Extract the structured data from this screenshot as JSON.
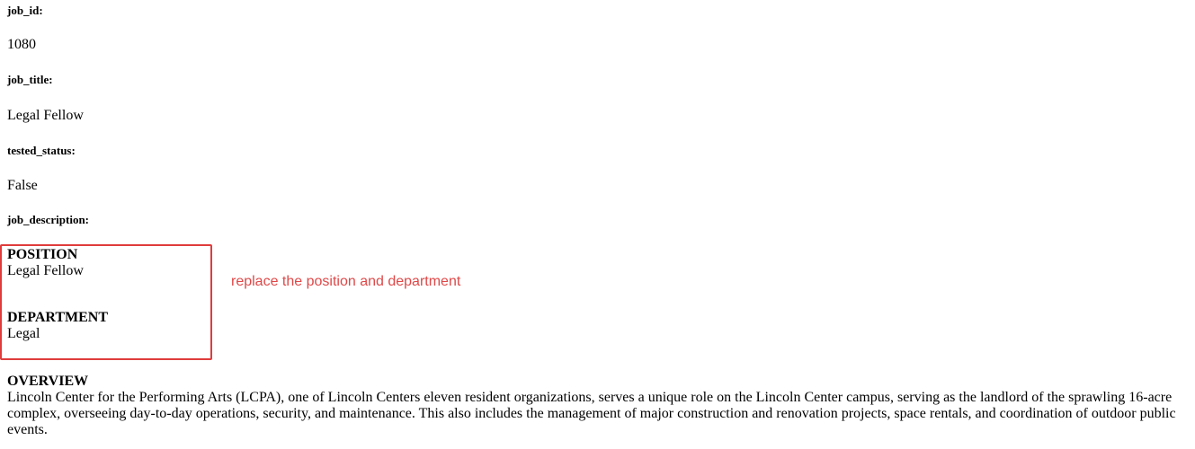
{
  "fields": {
    "job_id_label": "job_id:",
    "job_id_value": "1080",
    "job_title_label": "job_title:",
    "job_title_value": "Legal Fellow",
    "tested_status_label": "tested_status:",
    "tested_status_value": "False",
    "job_description_label": "job_description:"
  },
  "description": {
    "position_heading": "POSITION",
    "position_value": "Legal Fellow",
    "department_heading": "DEPARTMENT",
    "department_value": "Legal",
    "overview_heading": "OVERVIEW",
    "overview_text": "Lincoln Center for the Performing Arts (LCPA), one of Lincoln Centers eleven resident organizations, serves a unique role on the Lincoln Center campus, serving as the landlord of the sprawling 16-acre complex, overseeing day-to-day operations, security, and maintenance. This also includes the management of major construction and renovation projects, space rentals, and coordination of outdoor public events."
  },
  "annotation": {
    "text": "replace the position and department",
    "color": "#e04848",
    "box_color": "#e03c3c"
  }
}
